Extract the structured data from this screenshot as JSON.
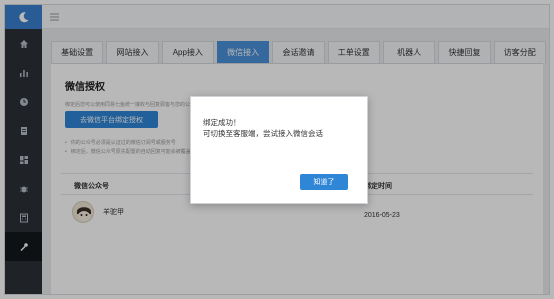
{
  "tabs": [
    "基础设置",
    "网站接入",
    "App接入",
    "微信接入",
    "会话邀请",
    "工单设置",
    "机器人",
    "快捷回复",
    "访客分配"
  ],
  "active_tab_index": 3,
  "section": {
    "title": "微信授权",
    "description": "绑定后您可以使用同易七鱼统一接收与回复顾客与您的公众号的消息",
    "bind_button": "去微信平台绑定授权",
    "tips": [
      "你的公众号必须是认证过的微信订阅号或服务号",
      "绑定后，微信公众号原先配置的自动回复可能会被覆盖"
    ]
  },
  "table": {
    "headers": [
      "微信公众号",
      "绑定时间"
    ],
    "rows": [
      {
        "name": "羊驼甲",
        "time": "2016-05-23"
      }
    ]
  },
  "modal": {
    "title": "绑定成功！",
    "message": "可切换至客服端，尝试接入微信会话",
    "ok_button": "知道了"
  },
  "colors": {
    "primary": "#2f86d6",
    "sidebar_bg": "#2b3036",
    "tab_active": "#4a90d9"
  }
}
